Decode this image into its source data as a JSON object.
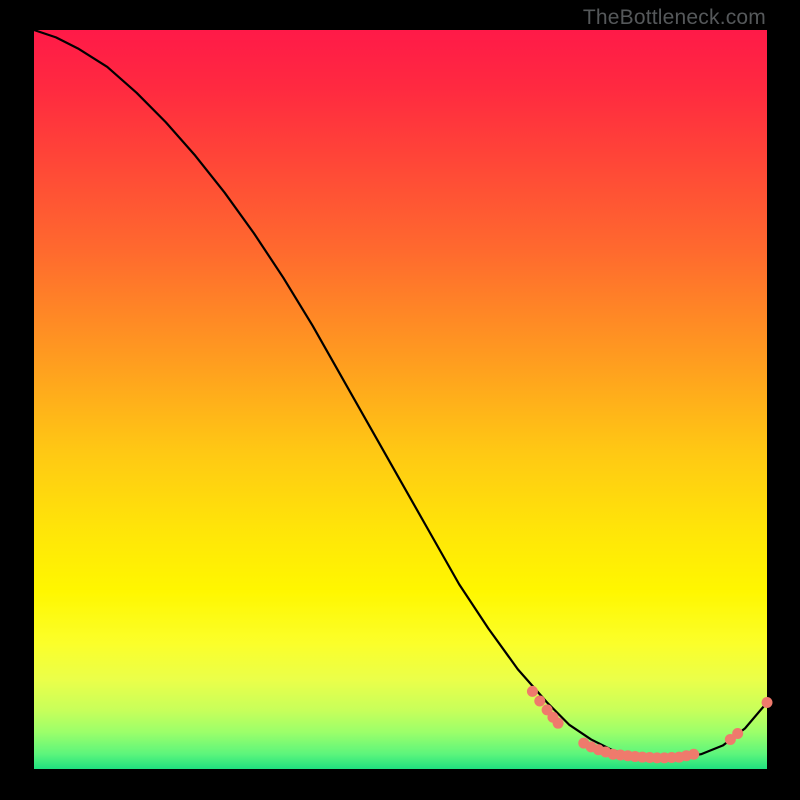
{
  "watermark": "TheBottleneck.com",
  "chart_data": {
    "type": "line",
    "title": "",
    "xlabel": "",
    "ylabel": "",
    "xlim": [
      0,
      100
    ],
    "ylim": [
      0,
      100
    ],
    "grid": false,
    "series": [
      {
        "name": "curve",
        "color": "#000000",
        "x": [
          0,
          3,
          6,
          10,
          14,
          18,
          22,
          26,
          30,
          34,
          38,
          42,
          46,
          50,
          54,
          58,
          62,
          66,
          70,
          73,
          76,
          79,
          82,
          85,
          88,
          91,
          94,
          97,
          100
        ],
        "y": [
          100,
          99,
          97.5,
          95,
          91.5,
          87.5,
          83,
          78,
          72.5,
          66.5,
          60,
          53,
          46,
          39,
          32,
          25,
          19,
          13.5,
          9,
          6,
          4,
          2.5,
          1.8,
          1.5,
          1.5,
          2,
          3.2,
          5.5,
          9
        ]
      }
    ],
    "markers": {
      "note": "salmon dots along lower valley and right tail",
      "color": "#ef7a6c",
      "points": [
        {
          "x": 68,
          "y": 10.5
        },
        {
          "x": 69,
          "y": 9.2
        },
        {
          "x": 70,
          "y": 8.0
        },
        {
          "x": 70.8,
          "y": 7.0
        },
        {
          "x": 71.5,
          "y": 6.2
        },
        {
          "x": 75,
          "y": 3.5
        },
        {
          "x": 76,
          "y": 3.0
        },
        {
          "x": 77,
          "y": 2.6
        },
        {
          "x": 78,
          "y": 2.3
        },
        {
          "x": 79,
          "y": 2.0
        },
        {
          "x": 80,
          "y": 1.9
        },
        {
          "x": 81,
          "y": 1.8
        },
        {
          "x": 82,
          "y": 1.7
        },
        {
          "x": 83,
          "y": 1.6
        },
        {
          "x": 84,
          "y": 1.55
        },
        {
          "x": 85,
          "y": 1.5
        },
        {
          "x": 86,
          "y": 1.5
        },
        {
          "x": 87,
          "y": 1.55
        },
        {
          "x": 88,
          "y": 1.6
        },
        {
          "x": 89,
          "y": 1.8
        },
        {
          "x": 90,
          "y": 2.0
        },
        {
          "x": 95,
          "y": 4.0
        },
        {
          "x": 96,
          "y": 4.8
        },
        {
          "x": 100,
          "y": 9.0
        }
      ]
    }
  }
}
